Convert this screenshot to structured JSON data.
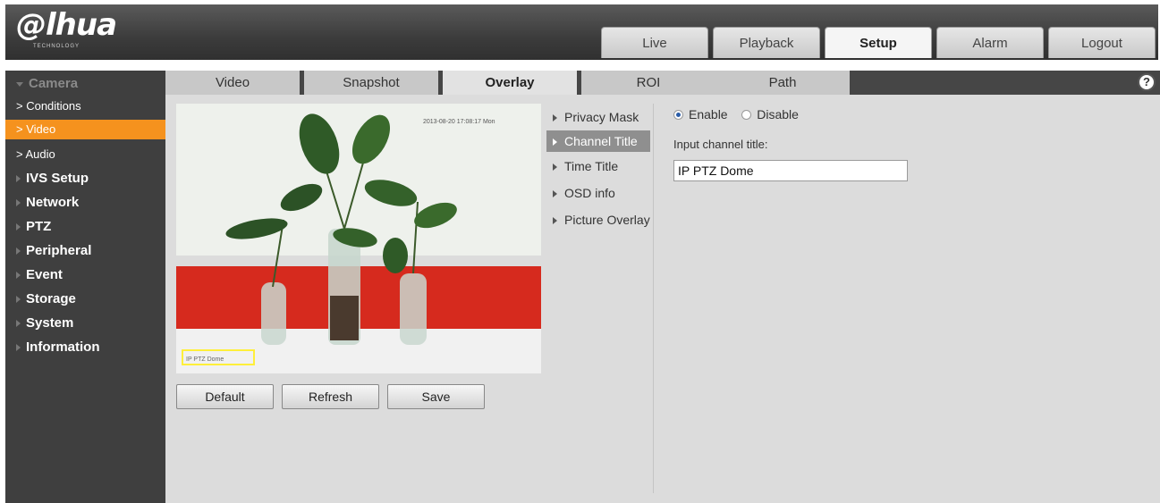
{
  "brand": {
    "logo_text": "alhua",
    "logo_sub": "TECHNOLOGY"
  },
  "topnav": [
    "Live",
    "Playback",
    "Setup",
    "Alarm",
    "Logout"
  ],
  "topnav_active": "Setup",
  "sidebar": {
    "camera": "Camera",
    "camera_items": [
      "> Conditions",
      "> Video",
      "> Audio"
    ],
    "camera_active": "> Video",
    "sections": [
      "IVS Setup",
      "Network",
      "PTZ",
      "Peripheral",
      "Event",
      "Storage",
      "System",
      "Information"
    ]
  },
  "subtabs": [
    "Video",
    "Snapshot",
    "Overlay",
    "ROI",
    "Path"
  ],
  "subtab_active": "Overlay",
  "help_icon": "?",
  "preview": {
    "timestamp_overlay": "2013-08-20 17:08:17 Mon",
    "channel_overlay": "IP PTZ Dome"
  },
  "buttons": {
    "default": "Default",
    "refresh": "Refresh",
    "save": "Save"
  },
  "overlay_menu": [
    "Privacy Mask",
    "Channel Title",
    "Time Title",
    "OSD info",
    "Picture Overlay"
  ],
  "overlay_active": "Channel Title",
  "form": {
    "enable_label": "Enable",
    "disable_label": "Disable",
    "enabled": true,
    "input_label": "Input channel title:",
    "channel_title_value": "IP PTZ Dome"
  },
  "colors": {
    "accent": "#f5921e",
    "sidebar_bg": "#3f3f3f",
    "content_bg": "#dcdcdc"
  },
  "icons": {
    "help": "help-icon",
    "menu_arrow": "triangle-right-icon",
    "collapse_arrow": "triangle-down-icon"
  }
}
